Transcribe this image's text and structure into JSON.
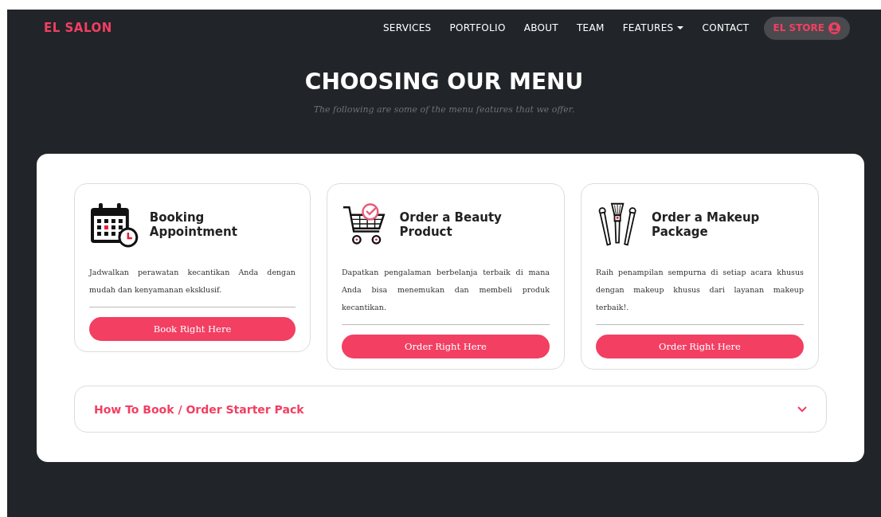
{
  "brand": "EL SALON",
  "nav": [
    {
      "label": "SERVICES",
      "kind": "link"
    },
    {
      "label": "PORTFOLIO",
      "kind": "link"
    },
    {
      "label": "ABOUT",
      "kind": "link"
    },
    {
      "label": "TEAM",
      "kind": "link"
    },
    {
      "label": "FEATURES",
      "kind": "dropdown"
    },
    {
      "label": "CONTACT",
      "kind": "link"
    }
  ],
  "store_button": "EL STORE",
  "heading": "CHOOSING OUR MENU",
  "subheading": "The following are some of the menu features that we offer.",
  "cards": [
    {
      "kind": "calendar",
      "title": "Booking Appointment",
      "text": "Jadwalkan perawatan kecantikan Anda dengan mudah dan kenyamanan eksklusif.",
      "button": "Book Right Here"
    },
    {
      "kind": "cart",
      "title": "Order a Beauty Product",
      "text": "Dapatkan pengalaman berbelanja terbaik di mana Anda bisa menemukan dan membeli produk kecantikan.",
      "button": "Order Right Here"
    },
    {
      "kind": "brushes",
      "title": "Order a Makeup Package",
      "text": "Raih penampilan sempurna di setiap acara khusus dengan makeup khusus dari layanan makeup terbaik!.",
      "button": "Order Right Here"
    }
  ],
  "accordion": {
    "title": "How To Book / Order Starter Pack",
    "expanded": false
  }
}
